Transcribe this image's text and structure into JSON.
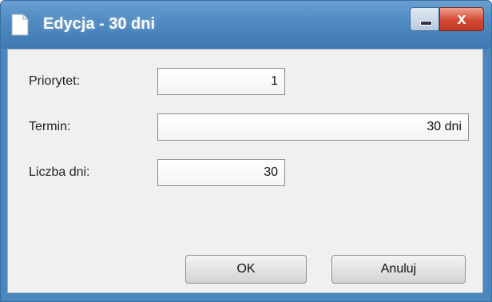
{
  "window": {
    "title": "Edycja - 30 dni",
    "title_icon": "document-icon",
    "minimize_label": "",
    "close_label": "x"
  },
  "form": {
    "priority": {
      "label": "Priorytet:",
      "value": "1"
    },
    "term": {
      "label": "Termin:",
      "value": "30 dni"
    },
    "days": {
      "label": "Liczba dni:",
      "value": "30"
    }
  },
  "buttons": {
    "ok": "OK",
    "cancel": "Anuluj"
  },
  "colors": {
    "titlebar": "#4f89c1",
    "close": "#c13a24",
    "dialog_bg": "#f0f0f0"
  }
}
